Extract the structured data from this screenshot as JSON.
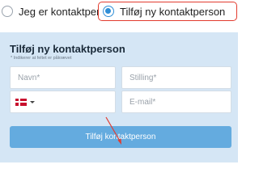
{
  "radio_group": {
    "options": [
      {
        "label": "Jeg er kontaktperson",
        "checked": false
      },
      {
        "label": "Tilføj ny kontaktperson",
        "checked": true
      }
    ]
  },
  "form": {
    "title": "Tilføj ny kontaktperson",
    "required_note": "* Indikerer at feltet er påkrævet",
    "name_placeholder": "Navn*",
    "title_placeholder": "Stilling*",
    "phone_country": "Denmark",
    "email_placeholder": "E-mail*",
    "submit_label": "Tilføj kontaktperson"
  },
  "colors": {
    "accent": "#2f8ed6",
    "panel_bg": "#d5e6f5",
    "button_bg": "#64abdf",
    "highlight": "#e23b2e"
  },
  "icons": {
    "flag": "denmark-flag-icon",
    "dropdown": "caret-down-icon",
    "annotation": "red-arrow-icon"
  }
}
